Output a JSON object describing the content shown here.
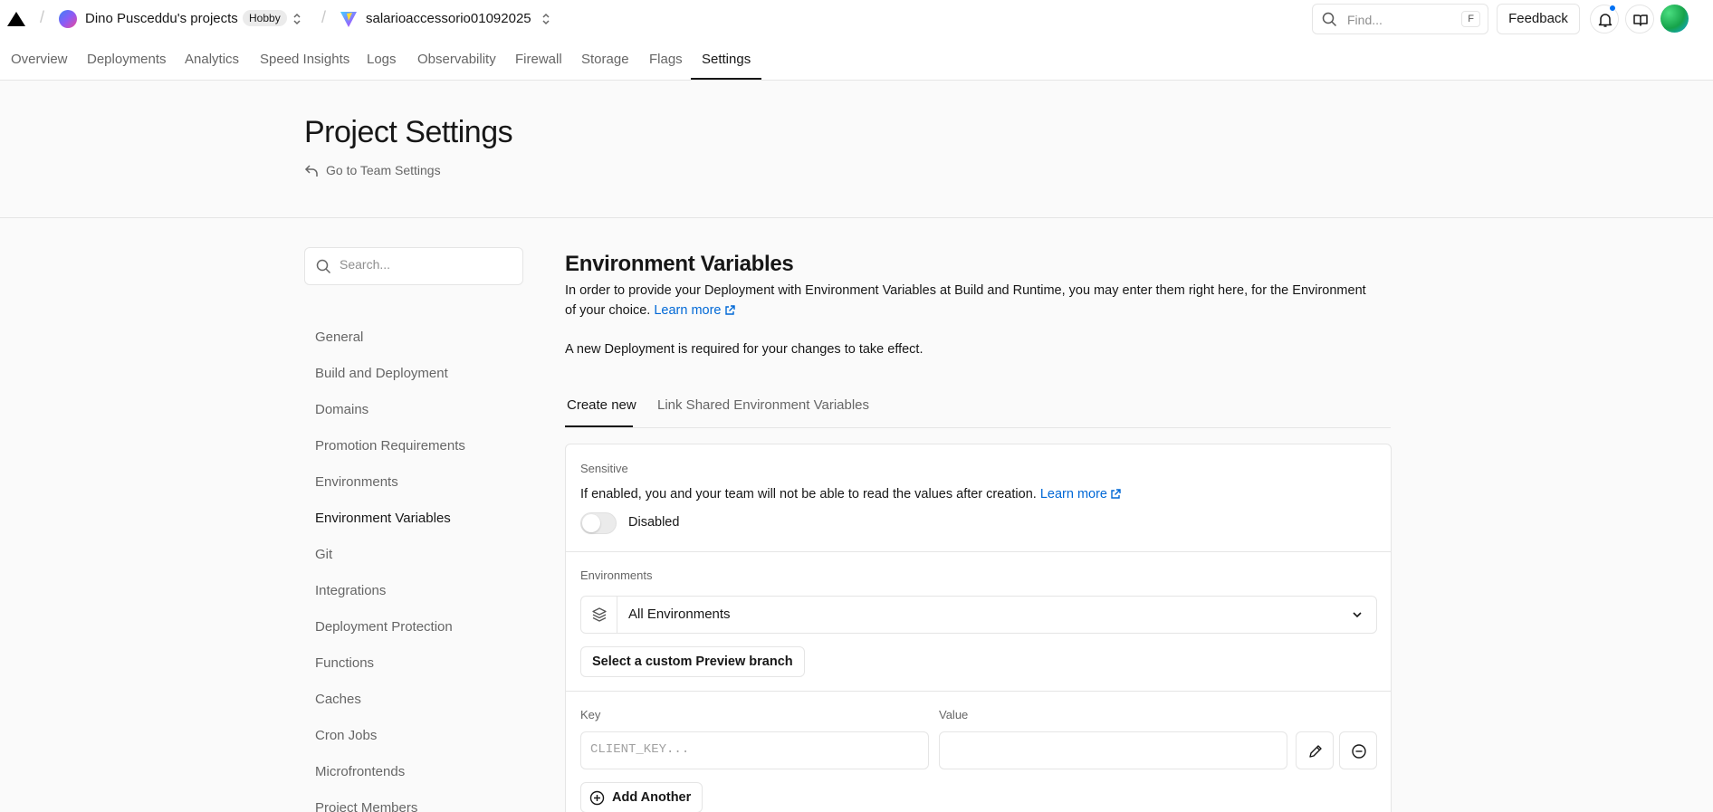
{
  "header": {
    "team_name": "Dino Pusceddu's projects",
    "plan_badge": "Hobby",
    "project_name": "salarioaccessorio01092025",
    "find_placeholder": "Find...",
    "find_shortcut": "F",
    "feedback_label": "Feedback"
  },
  "nav": {
    "tabs": [
      "Overview",
      "Deployments",
      "Analytics",
      "Speed Insights",
      "Logs",
      "Observability",
      "Firewall",
      "Storage",
      "Flags",
      "Settings"
    ],
    "active_tab": "Settings"
  },
  "page": {
    "title": "Project Settings",
    "back_link": "Go to Team Settings"
  },
  "sidebar": {
    "search_placeholder": "Search...",
    "items": [
      "General",
      "Build and Deployment",
      "Domains",
      "Promotion Requirements",
      "Environments",
      "Environment Variables",
      "Git",
      "Integrations",
      "Deployment Protection",
      "Functions",
      "Caches",
      "Cron Jobs",
      "Microfrontends",
      "Project Members"
    ],
    "active_item": "Environment Variables"
  },
  "env_vars": {
    "title": "Environment Variables",
    "description": "In order to provide your Deployment with Environment Variables at Build and Runtime, you may enter them right here, for the Environment of your choice.",
    "learn_more": "Learn more",
    "note": "A new Deployment is required for your changes to take effect.",
    "tabs": [
      "Create new",
      "Link Shared Environment Variables"
    ],
    "active_tab": "Create new",
    "sensitive": {
      "label": "Sensitive",
      "description": "If enabled, you and your team will not be able to read the values after creation.",
      "learn_more": "Learn more",
      "toggle_state": "Disabled",
      "enabled": false
    },
    "environments": {
      "label": "Environments",
      "selected": "All Environments",
      "custom_branch_button": "Select a custom Preview branch"
    },
    "key_label": "Key",
    "key_placeholder": "CLIENT_KEY...",
    "key_value": "",
    "value_label": "Value",
    "value_value": "",
    "add_another": "Add Another"
  },
  "colors": {
    "link": "#0068d6",
    "notification_dot": "#0070f3",
    "text": "#171717",
    "muted": "#666666",
    "border": "#e5e5e5"
  }
}
